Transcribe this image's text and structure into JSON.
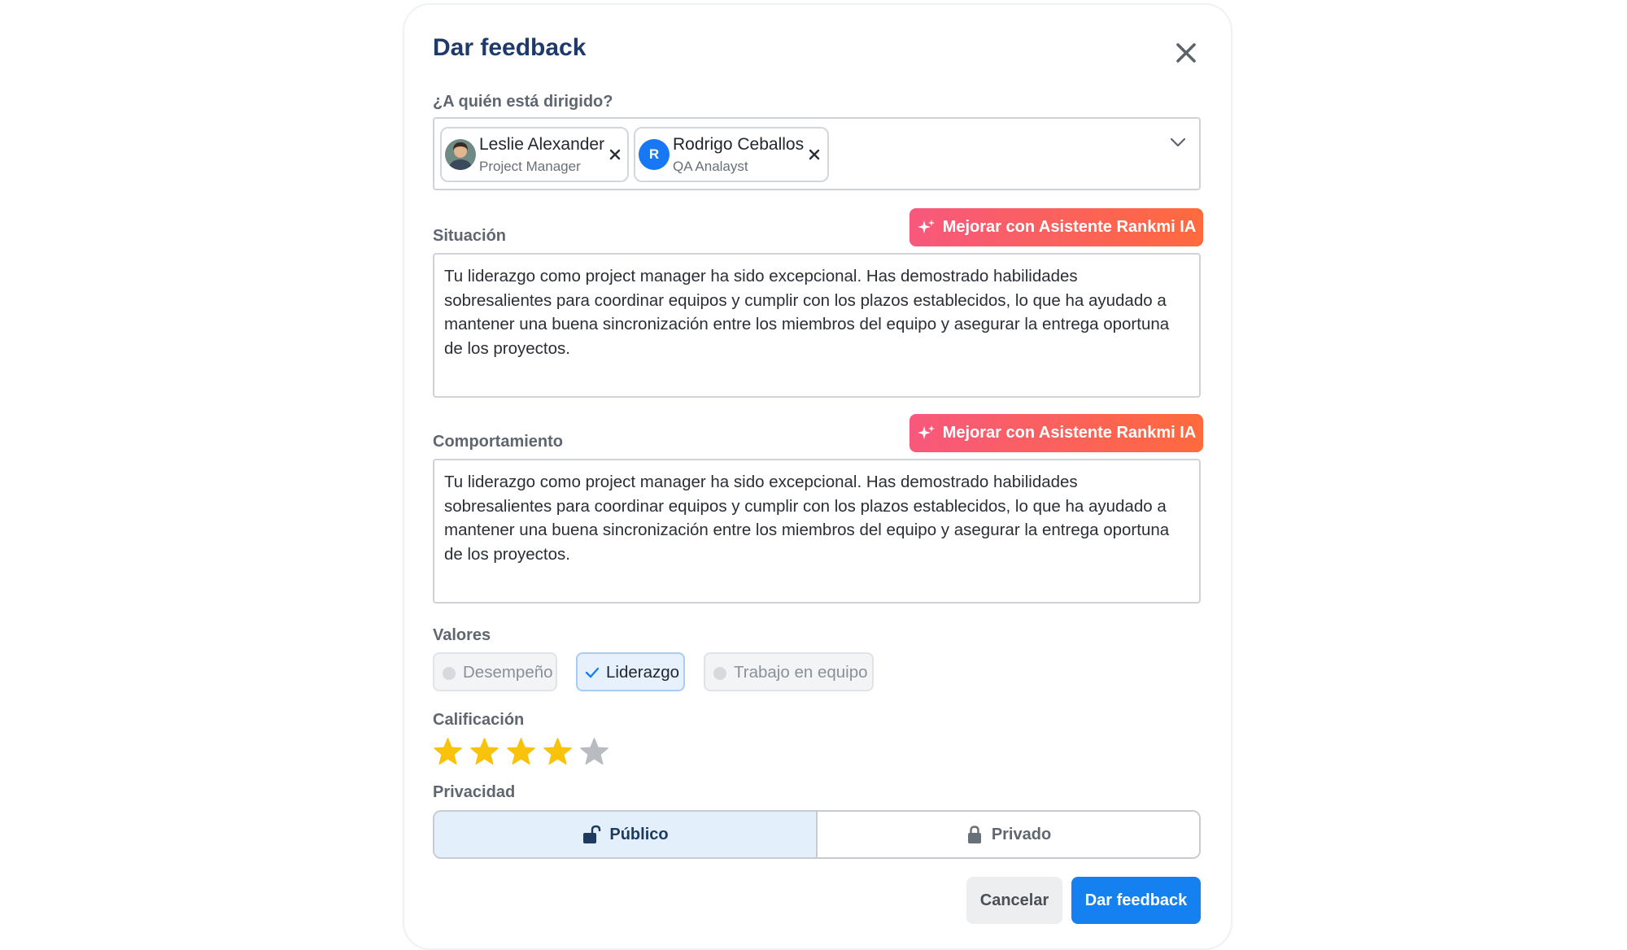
{
  "dialog": {
    "title": "Dar feedback"
  },
  "recipients": {
    "label": "¿A quién está dirigido?",
    "items": [
      {
        "name": "Leslie Alexander",
        "role": "Project Manager",
        "avatar": "photo"
      },
      {
        "name": "Rodrigo Ceballos",
        "role": "QA Analayst",
        "avatar_initial": "R"
      }
    ]
  },
  "situation": {
    "label": "Situación",
    "ai_button": "Mejorar con Asistente Rankmi IA",
    "text": "Tu liderazgo como project manager ha sido excepcional. Has demostrado habilidades sobresalientes para coordinar equipos y cumplir con los plazos establecidos, lo que ha ayudado a mantener una buena sincronización entre los miembros del equipo y asegurar la entrega oportuna de los proyectos."
  },
  "behavior": {
    "label": "Comportamiento",
    "ai_button": "Mejorar con Asistente Rankmi IA",
    "text": "Tu liderazgo como project manager ha sido excepcional. Has demostrado habilidades sobresalientes para coordinar equipos y cumplir con los plazos establecidos, lo que ha ayudado a mantener una buena sincronización entre los miembros del equipo y asegurar la entrega oportuna de los proyectos."
  },
  "values": {
    "label": "Valores",
    "options": [
      {
        "label": "Desempeño",
        "selected": false
      },
      {
        "label": "Liderazgo",
        "selected": true
      },
      {
        "label": "Trabajo en equipo",
        "selected": false
      }
    ]
  },
  "rating": {
    "label": "Calificación",
    "value": 4,
    "max": 5,
    "filled_color": "#f9c20b",
    "empty_color": "#b8bbbf"
  },
  "privacy": {
    "label": "Privacidad",
    "public_label": "Público",
    "private_label": "Privado",
    "selected": "public"
  },
  "actions": {
    "cancel_label": "Cancelar",
    "submit_label": "Dar feedback"
  },
  "colors": {
    "primary": "#1580f0",
    "title": "#1e3a6b",
    "ai_gradient_start": "#f7587d",
    "ai_gradient_end": "#ff6a3d"
  }
}
